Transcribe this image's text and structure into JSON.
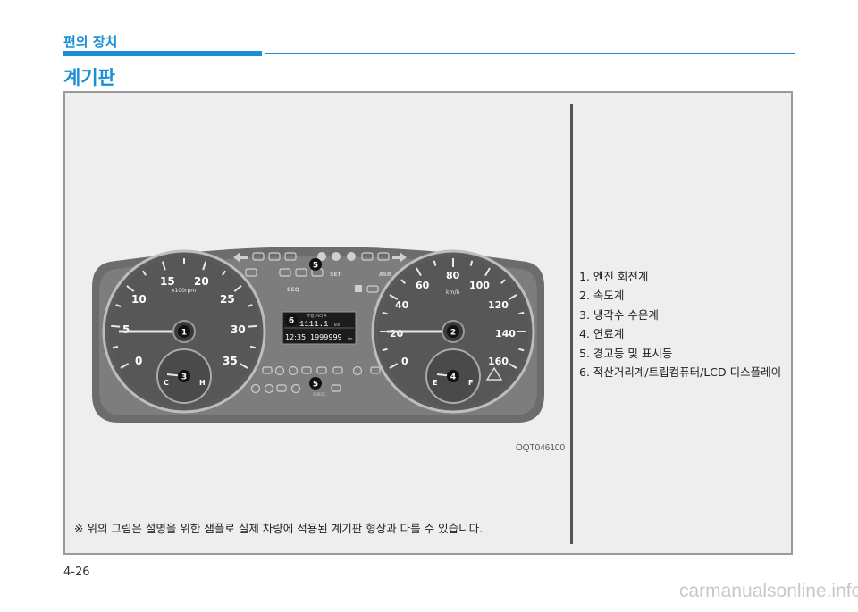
{
  "header": {
    "section_tag": "편의 장치",
    "page_title": "계기판"
  },
  "figure": {
    "code": "OQT046100",
    "legend": [
      "1. 엔진 회전계",
      "2. 속도계",
      "3. 냉각수 수온계",
      "4. 연료계",
      "5. 경고등 및 표시등",
      "6. 적산거리계/트립컴퓨터/LCD 디스플레이"
    ],
    "note": "※ 위의 그림은 설명을 위한 샘플로 실제 차량에 적용된 계기판 형상과 다를 수 있습니다.",
    "cluster": {
      "tacho_labels": [
        "0",
        "5",
        "10",
        "15",
        "20",
        "25",
        "30",
        "35"
      ],
      "tacho_unit": "x100rpm",
      "speedo_labels": [
        "0",
        "20",
        "40",
        "60",
        "80",
        "100",
        "120",
        "140",
        "160"
      ],
      "speedo_unit": "km/h",
      "temp_labels": [
        "C",
        "H"
      ],
      "fuel_labels": [
        "E",
        "F"
      ],
      "lcd_title": "주행 거리 A",
      "lcd_trip": "1111.1",
      "lcd_trip_unit": "km",
      "lcd_time": "12:35",
      "lcd_odo": "1999999",
      "lcd_odo_unit": "km",
      "callouts": [
        "1",
        "2",
        "3",
        "4",
        "5",
        "5",
        "6"
      ],
      "indicator_labels": [
        "SET",
        "ASR",
        "BEQ",
        "CHECK"
      ]
    }
  },
  "footer": {
    "page_number": "4-26",
    "watermark": "carmanualsonline.info"
  }
}
